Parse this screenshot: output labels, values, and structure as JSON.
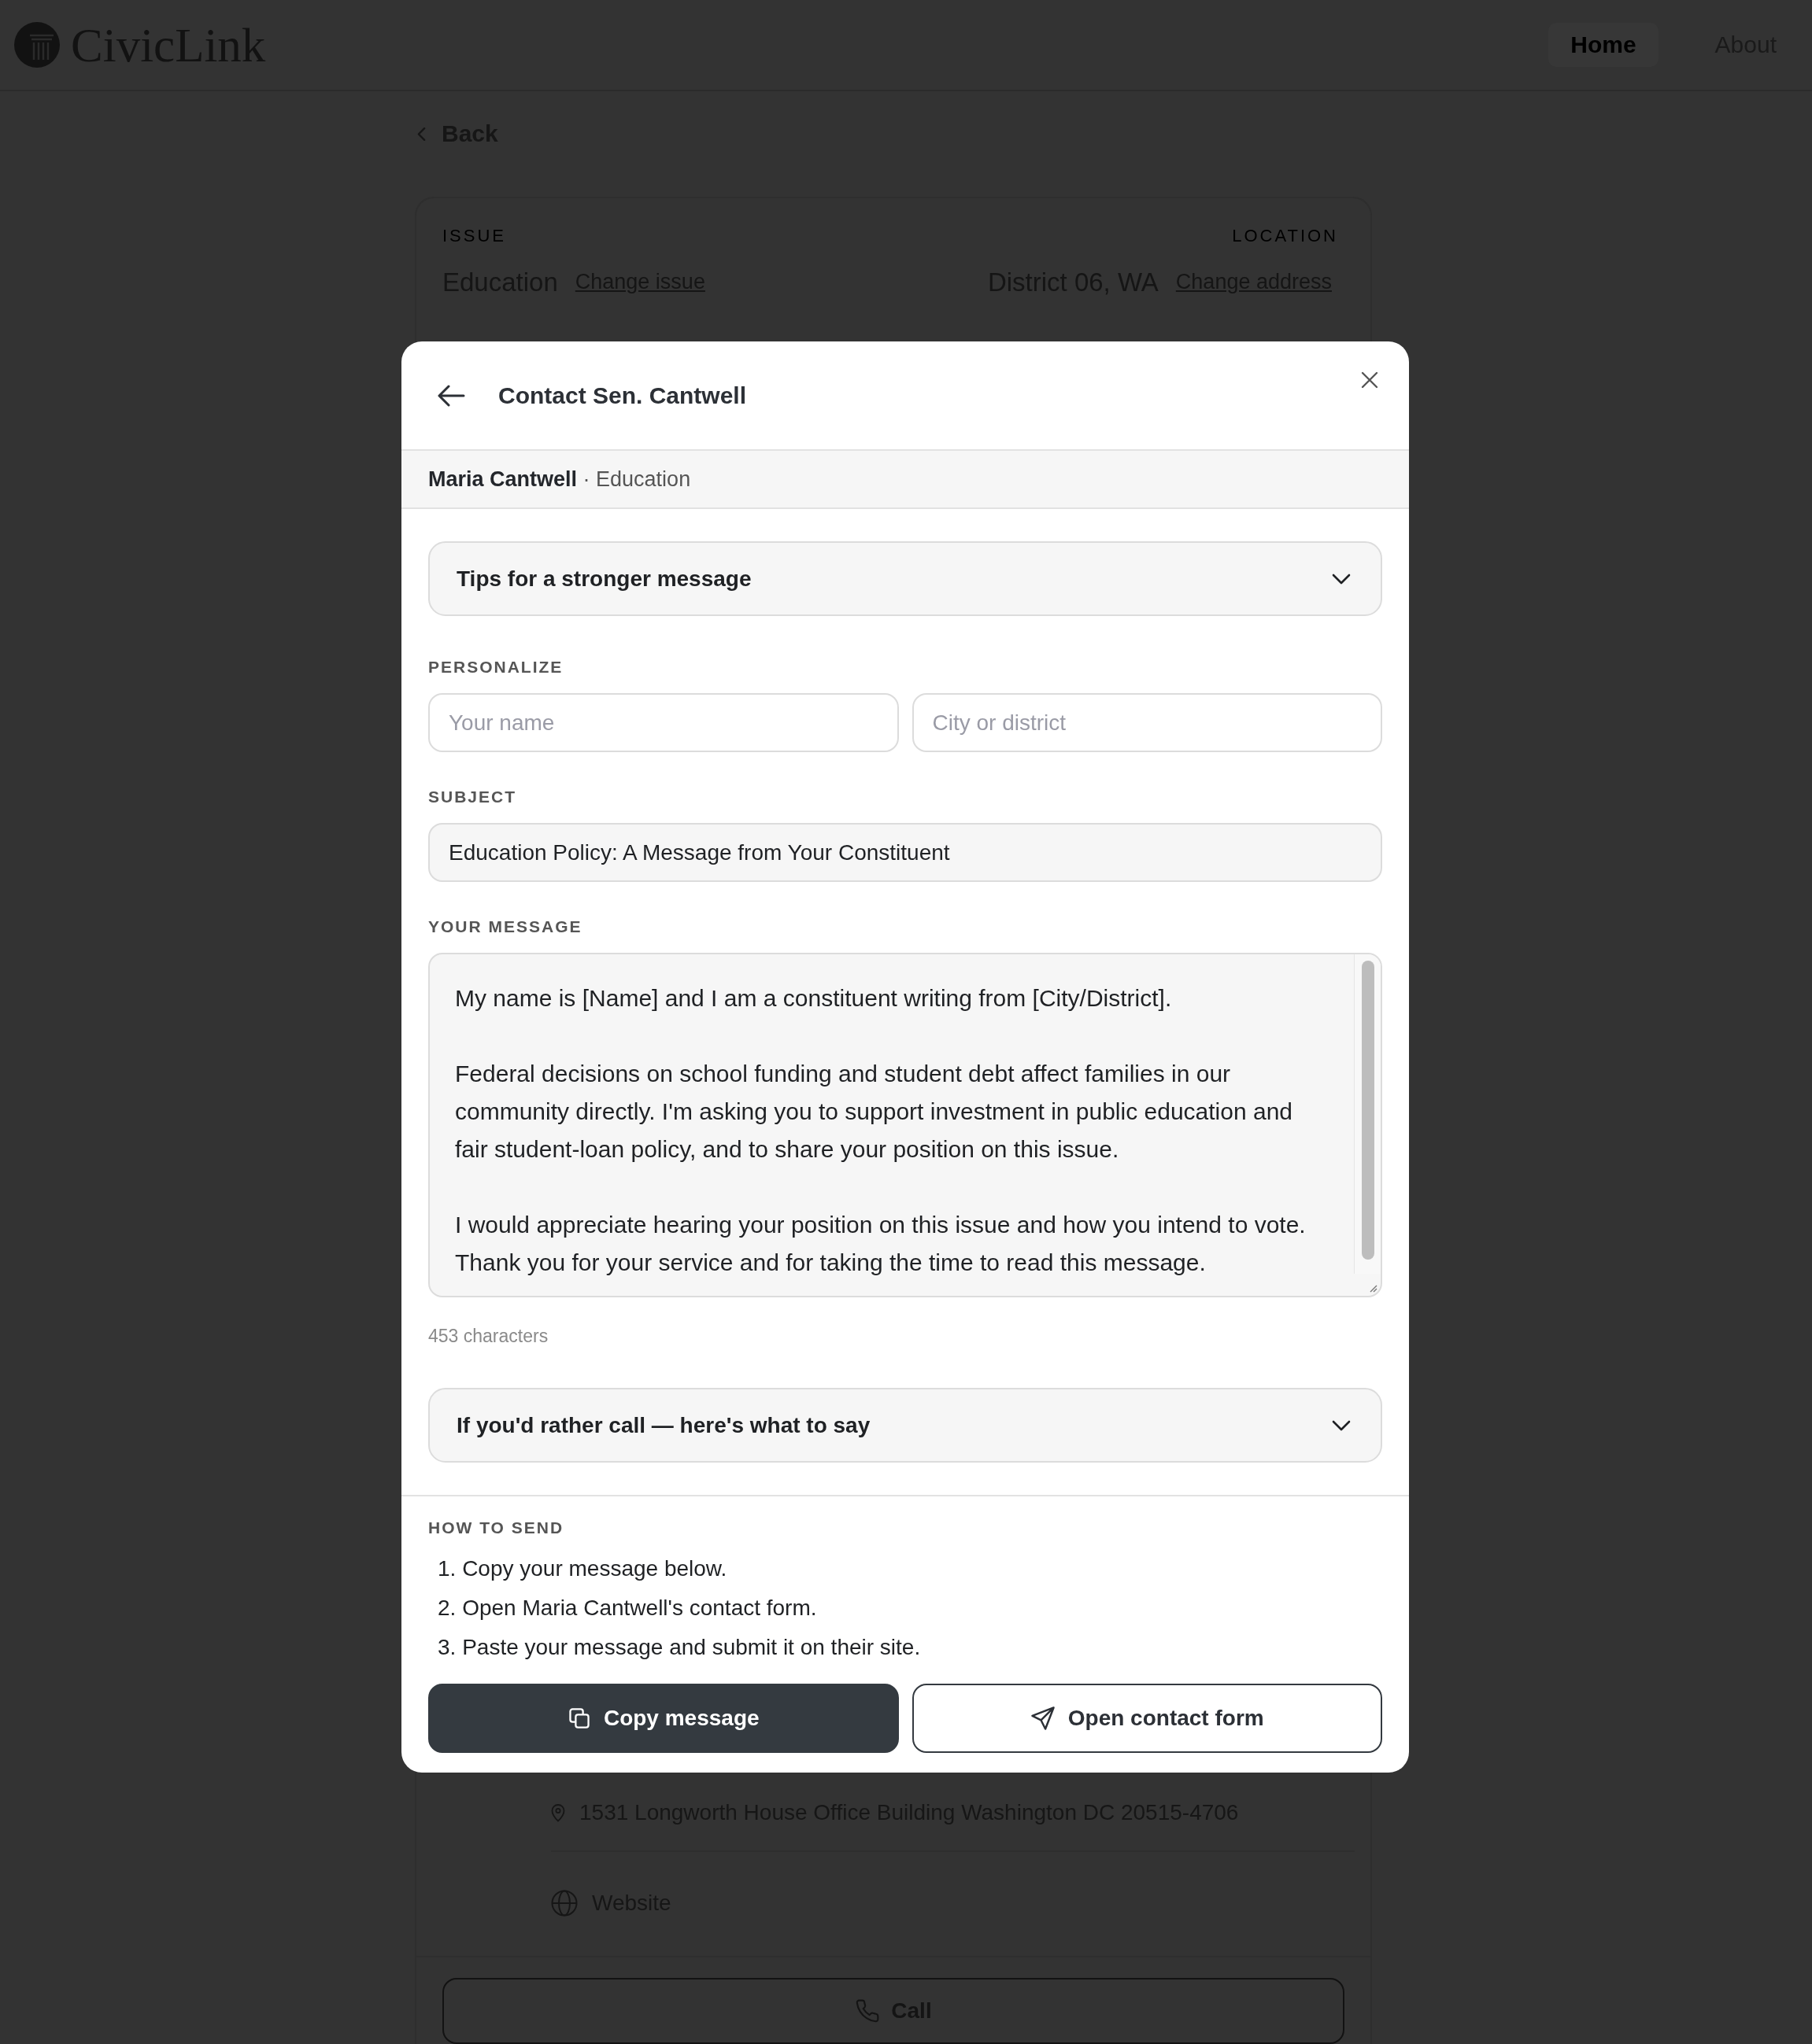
{
  "header": {
    "logo": "CivicLink",
    "nav": [
      {
        "label": "Home",
        "selected": true
      },
      {
        "label": "About",
        "selected": false
      }
    ]
  },
  "back": "Back",
  "summary": {
    "issue_label": "ISSUE",
    "issue": "Education",
    "change_issue": "Change issue",
    "location_label": "LOCATION",
    "location": "District 06, WA",
    "change_address": "Change address"
  },
  "office": {
    "address": "1531 Longworth House Office Building Washington DC 20515-4706",
    "website": "Website",
    "call": "Call"
  },
  "modal": {
    "title": "Contact Sen. Cantwell",
    "context": "**Maria Cantwell** · Education",
    "tips": {
      "label": "Tips for a stronger message",
      "expanded": false
    },
    "personalize": {
      "label": "PERSONALIZE",
      "fields": [
        {
          "placeholder": "Your name"
        },
        {
          "placeholder": "City or district"
        }
      ]
    },
    "subject": {
      "label": "SUBJECT",
      "value": "Education Policy: A Message from Your Constituent"
    },
    "message": {
      "label": "YOUR MESSAGE",
      "paragraphs": [
        "My name is [Name] and I am a constituent writing from [City/District].",
        "Federal decisions on school funding and student debt affect families in our community directly. I'm asking you to support investment in public education and fair student-loan policy, and to share your position on this issue.",
        "I would appreciate hearing your position on this issue and how you intend to vote. Thank you for your service and for taking the time to read this message."
      ],
      "count": "453 characters"
    },
    "call_script": {
      "label": "If you'd rather call — here's what to say",
      "expanded": false
    },
    "how_to_send": {
      "label": "HOW TO SEND",
      "steps": [
        "1. Copy your message below.",
        "2. Open Maria Cantwell's contact form.",
        "3. Paste your message and submit it on their site."
      ]
    },
    "actions": [
      {
        "label": "Copy message",
        "kind": "copy"
      },
      {
        "label": "Open contact form",
        "kind": "open_form"
      }
    ]
  }
}
